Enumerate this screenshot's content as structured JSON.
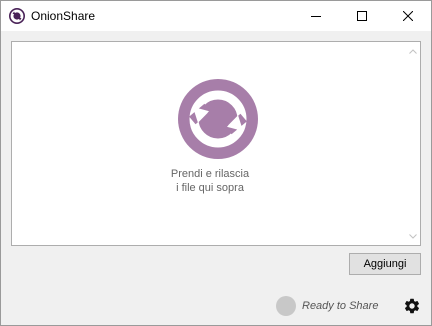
{
  "window": {
    "title": "OnionShare"
  },
  "icons": {
    "app": "onionshare-logo-icon",
    "minimize": "minimize-icon",
    "maximize": "maximize-icon",
    "close": "close-icon",
    "drop": "upload-sync-icon",
    "settings": "gear-icon"
  },
  "drop_area": {
    "line1": "Prendi e rilascia",
    "line2": "i file qui sopra"
  },
  "add_button": {
    "label": "Aggiungi"
  },
  "status": {
    "text": "Ready to Share"
  },
  "colors": {
    "accent": "#a77ea9",
    "logo": "#4a2358"
  }
}
